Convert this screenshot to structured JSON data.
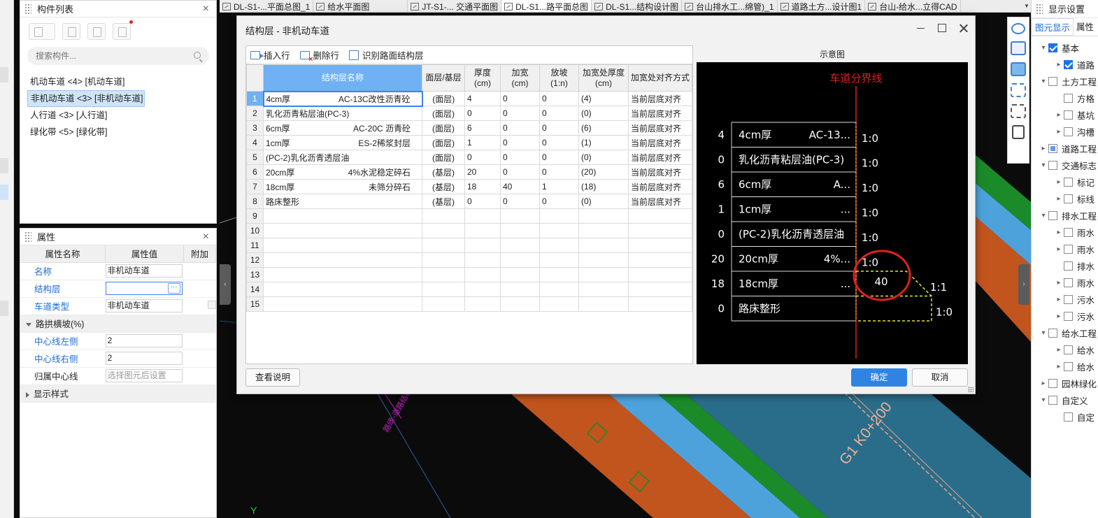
{
  "tabs": [
    {
      "label": "DL-S1-...平面总图_1",
      "active": false
    },
    {
      "label": "给水平面图",
      "active": false
    },
    {
      "label": "JT-S1-... 交通平面图",
      "active": false
    },
    {
      "label": "DL-S1...路平面总图",
      "active": true
    },
    {
      "label": "DL-S1...结构设计图",
      "active": false
    },
    {
      "label": "台山排水工...绵管)_1",
      "active": false
    },
    {
      "label": "道路土方...设计图1",
      "active": false
    },
    {
      "label": "台山-给水...立得CAD",
      "active": false
    }
  ],
  "component_panel": {
    "title": "构件列表",
    "search_placeholder": "搜索构件...",
    "items": [
      "机动车道 <4> [机动车道]",
      "非机动车道 <3> [非机动车道]",
      "人行道 <3> [人行道]",
      "绿化带 <5> [绿化带]"
    ],
    "selected_index": 1
  },
  "props_panel": {
    "title": "属性",
    "col_name": "属性名称",
    "col_value": "属性值",
    "col_extra": "附加",
    "rows": [
      {
        "name": "名称",
        "value": "非机动车道"
      },
      {
        "name": "结构层",
        "value": ""
      },
      {
        "name": "车道类型",
        "value": "非机动车道"
      }
    ],
    "group_crown": "路拱横坡(%)",
    "crown_rows": [
      {
        "name": "中心线左侧",
        "value": "2"
      },
      {
        "name": "中心线右侧",
        "value": "2"
      },
      {
        "name": "归属中心线",
        "value": "选择图元后设置"
      }
    ],
    "group_display": "显示样式"
  },
  "dialog": {
    "title": "结构层 - 非机动车道",
    "toolbar": {
      "insert": "插入行",
      "delete": "删除行",
      "recognize": "识别路面结构层"
    },
    "headers": [
      "结构层名称",
      "面层/基层",
      "厚度\n(cm)",
      "加宽\n(cm)",
      "放坡\n(1:n)",
      "加宽处厚度\n(cm)",
      "加宽处对齐方式"
    ],
    "rows": [
      {
        "n": "1",
        "thick_label": "4cm厚",
        "mat": "AC-13C改性沥青砼",
        "layer": "(面层)",
        "thickness": "4",
        "widen": "0",
        "slope": "0",
        "wthick": "(4)",
        "align": "当前层底对齐"
      },
      {
        "n": "2",
        "thick_label": "乳化沥青粘层油(PC-3)",
        "mat": "",
        "layer": "(面层)",
        "thickness": "0",
        "widen": "0",
        "slope": "0",
        "wthick": "(0)",
        "align": "当前层底对齐"
      },
      {
        "n": "3",
        "thick_label": "6cm厚",
        "mat": "AC-20C 沥青砼",
        "layer": "(面层)",
        "thickness": "6",
        "widen": "0",
        "slope": "0",
        "wthick": "(6)",
        "align": "当前层底对齐"
      },
      {
        "n": "4",
        "thick_label": "1cm厚",
        "mat": "ES-2稀浆封层",
        "layer": "(面层)",
        "thickness": "1",
        "widen": "0",
        "slope": "0",
        "wthick": "(1)",
        "align": "当前层底对齐"
      },
      {
        "n": "5",
        "thick_label": "(PC-2)乳化沥青透层油",
        "mat": "",
        "layer": "(面层)",
        "thickness": "0",
        "widen": "0",
        "slope": "0",
        "wthick": "(0)",
        "align": "当前层底对齐"
      },
      {
        "n": "6",
        "thick_label": "20cm厚",
        "mat": "4%水泥稳定碎石",
        "layer": "(基层)",
        "thickness": "20",
        "widen": "0",
        "slope": "0",
        "wthick": "(20)",
        "align": "当前层底对齐"
      },
      {
        "n": "7",
        "thick_label": "18cm厚",
        "mat": "未筛分碎石",
        "layer": "(基层)",
        "thickness": "18",
        "widen": "40",
        "slope": "1",
        "wthick": "(18)",
        "align": "当前层底对齐"
      },
      {
        "n": "8",
        "thick_label": "路床整形",
        "mat": "",
        "layer": "(基层)",
        "thickness": "0",
        "widen": "0",
        "slope": "0",
        "wthick": "(0)",
        "align": "当前层底对齐"
      }
    ],
    "empty_rows": [
      "9",
      "10",
      "11",
      "12",
      "13",
      "14",
      "15"
    ],
    "preview_title": "示意图",
    "preview": {
      "divider_label": "车道分界线",
      "layers": [
        {
          "num": "4",
          "text": "4cm厚",
          "text2": "AC-13...",
          "ratio": "1:0"
        },
        {
          "num": "0",
          "text": "乳化沥青粘层油(PC-3)",
          "text2": "",
          "ratio": "1:0"
        },
        {
          "num": "6",
          "text": "6cm厚",
          "text2": "A...",
          "ratio": "1:0"
        },
        {
          "num": "1",
          "text": "1cm厚",
          "text2": "...",
          "ratio": "1:0"
        },
        {
          "num": "0",
          "text": "(PC-2)乳化沥青透层油",
          "text2": "",
          "ratio": "1:0"
        },
        {
          "num": "20",
          "text": "20cm厚",
          "text2": "4%...",
          "ratio": "1:0"
        },
        {
          "num": "18",
          "text": "18cm厚",
          "text2": "...",
          "ratio": "1:1"
        },
        {
          "num": "0",
          "text": "路床整形",
          "text2": "",
          "ratio": "1:0"
        }
      ],
      "widen_label": "40",
      "colors": {
        "divider": "#e0201d",
        "layer": "#e6e632",
        "text": "#ffffff",
        "circle": "#e0201d"
      }
    },
    "btn_help": "查看说明",
    "btn_ok": "确定",
    "btn_cancel": "取消"
  },
  "right_panel": {
    "title": "显示设置",
    "tab_display": "图元显示",
    "tab_props": "属性",
    "tree": [
      {
        "label": "基本",
        "level": 0,
        "state": "checked",
        "expand": "down"
      },
      {
        "label": "道路",
        "level": 1,
        "state": "checked",
        "expand": "right"
      },
      {
        "label": "土方工程",
        "level": 0,
        "state": "empty",
        "expand": "down"
      },
      {
        "label": "方格",
        "level": 1,
        "state": "empty",
        "expand": ""
      },
      {
        "label": "基坑",
        "level": 1,
        "state": "empty",
        "expand": "right"
      },
      {
        "label": "沟槽",
        "level": 1,
        "state": "empty",
        "expand": "right"
      },
      {
        "label": "道路工程",
        "level": 0,
        "state": "partial",
        "expand": "right"
      },
      {
        "label": "交通标志",
        "level": 0,
        "state": "empty",
        "expand": "down"
      },
      {
        "label": "标记",
        "level": 1,
        "state": "empty",
        "expand": "right"
      },
      {
        "label": "标线",
        "level": 1,
        "state": "empty",
        "expand": "right"
      },
      {
        "label": "排水工程",
        "level": 0,
        "state": "empty",
        "expand": "down"
      },
      {
        "label": "雨水",
        "level": 1,
        "state": "empty",
        "expand": "right"
      },
      {
        "label": "雨水",
        "level": 1,
        "state": "empty",
        "expand": "right"
      },
      {
        "label": "排水",
        "level": 1,
        "state": "empty",
        "expand": ""
      },
      {
        "label": "雨水",
        "level": 1,
        "state": "empty",
        "expand": "right"
      },
      {
        "label": "污水",
        "level": 1,
        "state": "empty",
        "expand": "right"
      },
      {
        "label": "污水",
        "level": 1,
        "state": "empty",
        "expand": "right"
      },
      {
        "label": "给水工程",
        "level": 0,
        "state": "empty",
        "expand": "down"
      },
      {
        "label": "给水",
        "level": 1,
        "state": "empty",
        "expand": "right"
      },
      {
        "label": "给水",
        "level": 1,
        "state": "empty",
        "expand": "right"
      },
      {
        "label": "园林绿化",
        "level": 0,
        "state": "empty",
        "expand": "right"
      },
      {
        "label": "自定义",
        "level": 0,
        "state": "empty",
        "expand": "down"
      },
      {
        "label": "自定",
        "level": 1,
        "state": "empty",
        "expand": ""
      }
    ]
  },
  "canvas": {
    "station_label": "G1 K0+200",
    "y_axis": "Y",
    "magenta_label": "路缘-道路结构层"
  }
}
